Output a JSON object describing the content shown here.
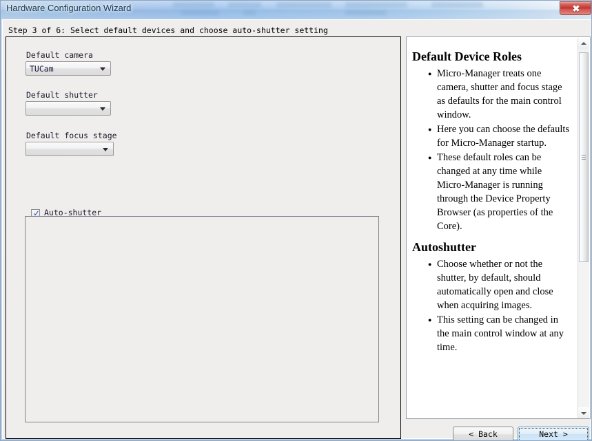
{
  "window": {
    "title": "Hardware Configuration Wizard",
    "close_glyph": "✖"
  },
  "step": {
    "label": "Step 3 of 6: Select default devices and choose auto-shutter setting"
  },
  "form": {
    "camera": {
      "label": "Default camera",
      "value": "TUCam"
    },
    "shutter": {
      "label": "Default shutter",
      "value": ""
    },
    "focus": {
      "label": "Default focus stage",
      "value": ""
    },
    "autoshutter": {
      "label": "Auto-shutter",
      "checked": true,
      "check_glyph": "✓"
    }
  },
  "help": {
    "sections": [
      {
        "heading": "Default Device Roles",
        "bullets": [
          "Micro-Manager treats one camera, shutter and focus stage as defaults for the main control window.",
          "Here you can choose the defaults for Micro-Manager startup.",
          "These default roles can be changed at any time while Micro-Manager is running through the Device Property Browser (as properties of the Core)."
        ]
      },
      {
        "heading": "Autoshutter",
        "bullets": [
          "Choose whether or not the shutter, by default, should automatically open and close when acquiring images.",
          "This setting can be changed in the main control window at any time."
        ]
      }
    ],
    "scrollbar": {
      "up_arrow": "up-arrow",
      "down_arrow": "down-arrow"
    }
  },
  "footer": {
    "back_label": "< Back",
    "next_label": "Next >"
  },
  "colors": {
    "titlebar_accent": "#8ab6e6",
    "close_button": "#c0302a",
    "focus_border": "#5c9ccc",
    "checkbox_tick": "#1d4fb0",
    "panel_border": "#000000"
  }
}
